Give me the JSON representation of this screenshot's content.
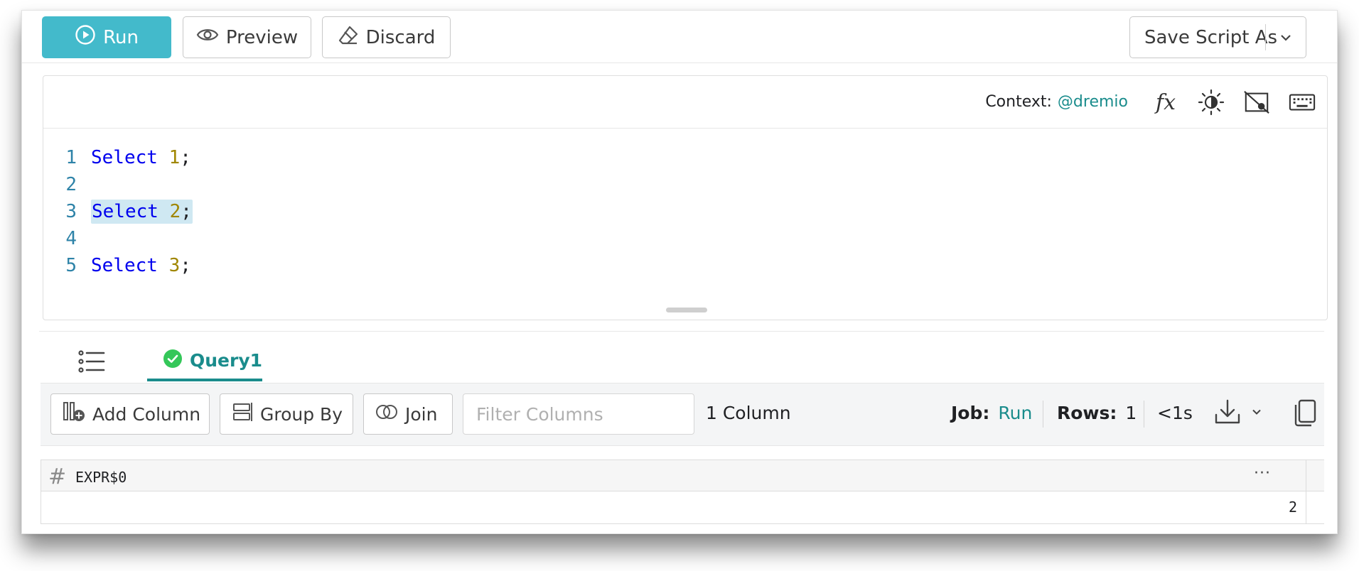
{
  "toolbar": {
    "run_label": "Run",
    "preview_label": "Preview",
    "discard_label": "Discard",
    "save_label": "Save Script As"
  },
  "editor": {
    "context_label": "Context:",
    "context_value": "@dremio",
    "fx_label": "fx",
    "icons": [
      "function-icon",
      "theme-toggle-icon",
      "hide-preview-icon",
      "keyboard-icon"
    ],
    "lines": [
      {
        "num": "1",
        "kw": "Select",
        "val": "1",
        "end": ";"
      },
      {
        "num": "2",
        "kw": "",
        "val": "",
        "end": ""
      },
      {
        "num": "3",
        "kw": "Select",
        "val": "2",
        "end": ";"
      },
      {
        "num": "4",
        "kw": "",
        "val": "",
        "end": ""
      },
      {
        "num": "5",
        "kw": "Select",
        "val": "3",
        "end": ";"
      }
    ]
  },
  "tabs": {
    "query_label": "Query1",
    "query_status": "success"
  },
  "results": {
    "add_column": "Add Column",
    "group_by": "Group By",
    "join": "Join",
    "filter_placeholder": "Filter Columns",
    "column_count": "1 Column",
    "job_label": "Job:",
    "job_value": "Run",
    "rows_label": "Rows:",
    "rows_value": "1",
    "time": "<1s"
  },
  "grid": {
    "column_type_symbol": "#",
    "column_name": "EXPR$0",
    "column_menu": "···",
    "rows": [
      [
        "2"
      ]
    ]
  },
  "colors": {
    "accent": "#43bacb",
    "link": "#1a8c8c",
    "success": "#34c759",
    "keyword": "#0000ee",
    "number": "#a08600",
    "highlight": "#cfe8f2"
  }
}
